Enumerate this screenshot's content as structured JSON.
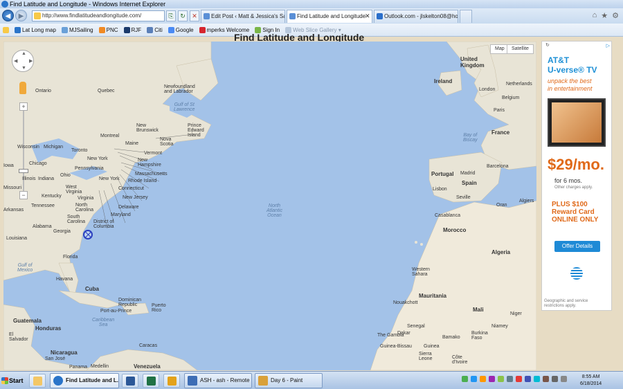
{
  "window": {
    "title": "Find Latitude and Longitude - Windows Internet Explorer"
  },
  "address_bar": {
    "url": "http://www.findlatitudeandlongitude.com/"
  },
  "tabs": [
    {
      "label": "Edit Post ‹ Matt & Jessica's Saili...",
      "active": false
    },
    {
      "label": "Find Latitude and Longitude",
      "active": true
    },
    {
      "label": "Outlook.com - jlskelton08@hot...",
      "active": false
    }
  ],
  "favorites": [
    {
      "label": "Lat Long map",
      "color": "#2a74c9"
    },
    {
      "label": "MJSailing",
      "color": "#6aa0d8"
    },
    {
      "label": "PNC",
      "color": "#f08a24"
    },
    {
      "label": "RJF",
      "color": "#1b3a6b"
    },
    {
      "label": "Citi",
      "color": "#5a7fb8"
    },
    {
      "label": "Google",
      "color": "#4a8af4"
    },
    {
      "label": "mperks Welcome",
      "color": "#d6262e"
    },
    {
      "label": "Sign In",
      "color": "#7ab648"
    },
    {
      "label": "Web Slice Gallery ▾",
      "color": "#b7c8dc"
    }
  ],
  "page": {
    "heading": "Find Latitude and Longitude",
    "map_type": {
      "map": "Map",
      "satellite": "Satellite"
    },
    "labels": {
      "united_kingdom": "United\nKingdom",
      "ireland": "Ireland",
      "london": "London",
      "netherlands": "Netherlands",
      "belgium": "Belgium",
      "paris": "Paris",
      "france": "France",
      "bay_of_biscay": "Bay of\nBiscay",
      "portugal": "Portugal",
      "madrid": "Madrid",
      "barcelona": "Barcelona",
      "spain": "Spain",
      "lisbon": "Lisbon",
      "seville": "Seville",
      "algiers": "Algiers",
      "oran": "Oran",
      "casablanca": "Casablanca",
      "morocco": "Morocco",
      "algeria": "Algeria",
      "western_sahara": "Western\nSahara",
      "mauritania": "Mauritania",
      "mali": "Mali",
      "nouakchott": "Nouakchott",
      "senegal": "Senegal",
      "dakar": "Dakar",
      "the_gambia": "The Gambia",
      "guinea_bissau": "Guinea-Bissau",
      "guinea": "Guinea",
      "sierra_leone": "Sierra\nLeone",
      "bamako": "Bamako",
      "burkina_faso": "Burkina\nFaso",
      "niamey": "Niamey",
      "niger": "Niger",
      "cote_divoire": "Côte\nd'Ivoire",
      "north_atlantic_ocean": "North\nAtlantic\nOcean",
      "united_kingdom_ireland": "",
      "ontario": "Ontario",
      "quebec": "Quebec",
      "newfoundland": "Newfoundland\nand Labrador",
      "gulf_st_lawrence": "Gulf of St\nLawrence",
      "new_brunswick": "New\nBrunswick",
      "prince_edward": "Prince\nEdward\nIsland",
      "nova_scotia": "Nova\nScotia",
      "montreal": "Montreal",
      "maine": "Maine",
      "vermont": "Vermont",
      "new_hampshire": "New\nHampshire",
      "massachusetts": "Massachusetts",
      "rhode_island": "Rhode Island",
      "connecticut": "Connecticut",
      "new_jersey": "New Jersey",
      "delaware": "Delaware",
      "maryland": "Maryland",
      "district_columbia": "District of\nColumbia",
      "toronto": "Toronto",
      "wisconsin": "Wisconsin",
      "michigan": "Michigan",
      "chicago": "Chicago",
      "iowa": "Iowa",
      "illinois": "Illinois",
      "indiana": "Indiana",
      "ohio": "Ohio",
      "pennsylvania": "Pennsylvania",
      "new_york_state": "New York",
      "new_york_city": "New York",
      "west_virginia": "West\nVirginia",
      "virginia": "Virginia",
      "kentucky": "Kentucky",
      "missouri": "Missouri",
      "tennessee": "Tennessee",
      "north_carolina": "North\nCarolina",
      "south_carolina": "South\nCarolina",
      "arkansas": "Arkansas",
      "alabama": "Alabama",
      "georgia": "Georgia",
      "louisiana": "Louisiana",
      "florida": "Florida",
      "gulf_of_mexico": "Gulf of\nMexico",
      "havana": "Havana",
      "cuba": "Cuba",
      "dominican": "Dominican\nRepublic",
      "puerto_rico": "Puerto\nRico",
      "port_au_prince": "Port-au-Prince",
      "caribbean": "Caribbean\nSea",
      "guatemala": "Guatemala",
      "honduras": "Honduras",
      "el_salvador": "El\nSalvador",
      "nicaragua": "Nicaragua",
      "caracas": "Caracas",
      "venezuela": "Venezuela",
      "panama": "Panama",
      "medellin": "Medellin",
      "san_jose": "San José"
    }
  },
  "ad": {
    "brand_line1": "AT&T",
    "brand_line2": "U-verse® TV",
    "tagline": "unpack the best\nin entertainment",
    "price": "$29/mo.",
    "term": "for 6 mos.",
    "other_charges": "Other charges apply.",
    "plus_line1": "PLUS $100",
    "plus_line2": "Reward Card",
    "plus_line3": "ONLINE ONLY",
    "offer_button": "Offer Details",
    "disclaimer": "Geographic and service\nrestrictions apply.",
    "ad_choice": "▷"
  },
  "taskbar": {
    "start": "Start",
    "buttons": [
      {
        "label": "Find Latitude and L...",
        "active": true
      },
      {
        "label": "ASH - ash - Remote D...",
        "active": false
      },
      {
        "label": "Day 6 - Paint",
        "active": false
      }
    ],
    "time": "8:55 AM",
    "date": "6/18/2014"
  },
  "colors": {
    "water": "#a3c2e8",
    "land": "#e8e4d6",
    "desert": "#f0eadb",
    "accent": "#1e8ad6"
  }
}
